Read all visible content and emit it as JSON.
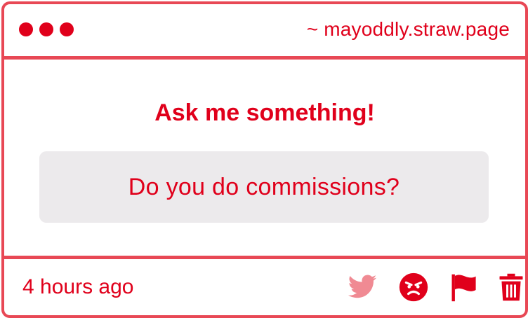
{
  "window": {
    "url": "~ mayoddly.straw.page",
    "controls": [
      "red-dot",
      "red-dot",
      "red-dot"
    ]
  },
  "main": {
    "heading": "Ask me something!",
    "question": "Do you do commissions?"
  },
  "footer": {
    "timestamp": "4 hours ago",
    "actions": [
      {
        "icon": "twitter-icon",
        "color": "#f08a93"
      },
      {
        "icon": "angry-face-icon",
        "color": "#e0001b"
      },
      {
        "icon": "flag-icon",
        "color": "#e0001b"
      },
      {
        "icon": "trash-icon",
        "color": "#e0001b"
      }
    ]
  },
  "colors": {
    "accent": "#e0001b",
    "border": "#e84855",
    "question_bg": "#eceaec",
    "twitter_muted": "#f08a93"
  }
}
